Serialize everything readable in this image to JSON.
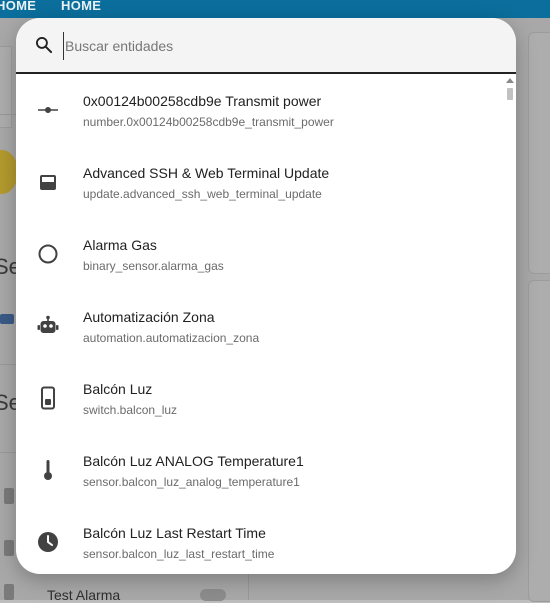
{
  "background": {
    "tabs": [
      "HOME",
      "HOME"
    ],
    "heading_1": "Se",
    "heading_2": "Se",
    "toggle_label": "Test Alarma"
  },
  "search": {
    "placeholder": "Buscar entidades",
    "value": ""
  },
  "entities": [
    {
      "name": "0x00124b00258cdb9e Transmit power",
      "entity_id": "number.0x00124b00258cdb9e_transmit_power",
      "icon": "slider-icon"
    },
    {
      "name": "Advanced SSH & Web Terminal Update",
      "entity_id": "update.advanced_ssh_web_terminal_update",
      "icon": "package-icon"
    },
    {
      "name": "Alarma Gas",
      "entity_id": "binary_sensor.alarma_gas",
      "icon": "circle-outline-icon"
    },
    {
      "name": "Automatización Zona",
      "entity_id": "automation.automatizacion_zona",
      "icon": "robot-icon"
    },
    {
      "name": "Balcón Luz",
      "entity_id": "switch.balcon_luz",
      "icon": "switch-icon"
    },
    {
      "name": "Balcón Luz ANALOG Temperature1",
      "entity_id": "sensor.balcon_luz_analog_temperature1",
      "icon": "thermometer-icon"
    },
    {
      "name": "Balcón Luz Last Restart Time",
      "entity_id": "sensor.balcon_luz_last_restart_time",
      "icon": "clock-icon"
    }
  ],
  "colors": {
    "header": "#0b6e9c",
    "icon": "#424242"
  }
}
